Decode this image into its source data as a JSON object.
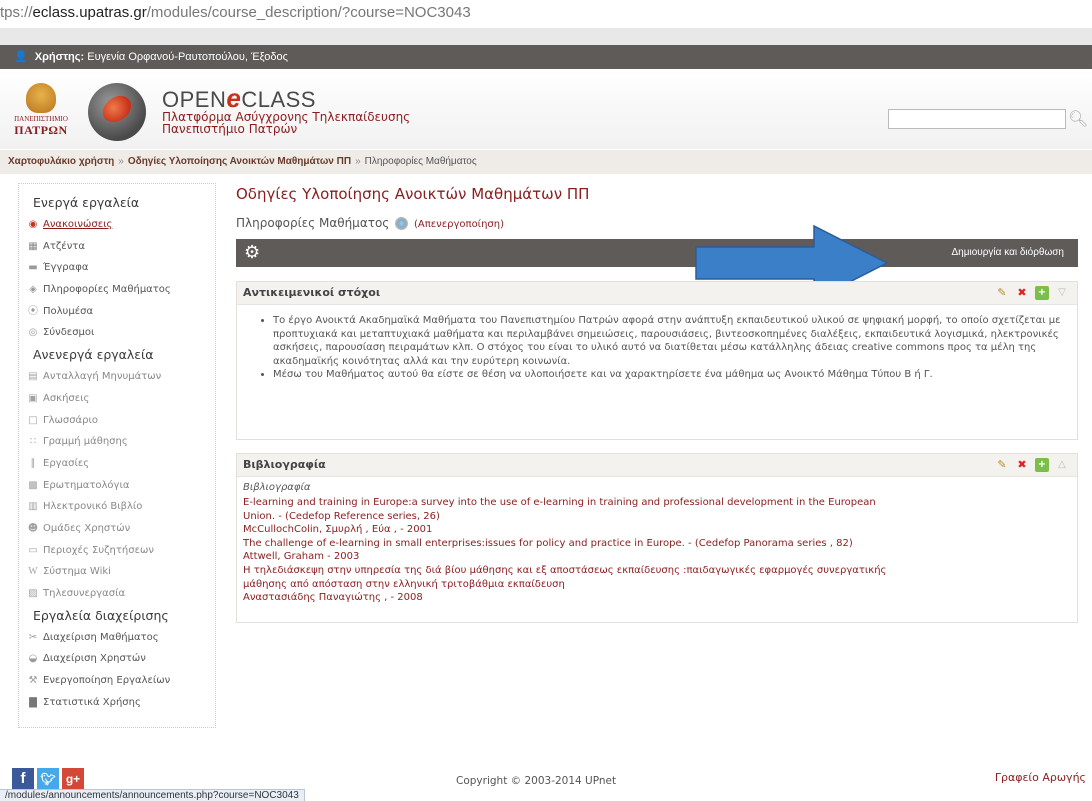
{
  "browser": {
    "url_prefix": "tps://",
    "url_host": "eclass.upatras.gr",
    "url_path": "/modules/course_description/?course=NOC3043",
    "status_url": "/modules/announcements/announcements.php?course=NOC3043"
  },
  "userbar": {
    "label": "Χρήστης:",
    "user": "Ευγενία Ορφανού-Ραυτοπούλου",
    "separator": ",",
    "logout": "Έξοδος"
  },
  "header": {
    "uni_line1": "ΠΑΝΕΠΙΣΤΗΜΙΟ",
    "uni_line2": "ΠΑΤΡΩΝ",
    "brand_open": "OPEN",
    "brand_e": "e",
    "brand_class": "CLASS",
    "subtitle1": "Πλατφόρμα Ασύγχρονης Τηλεκπαίδευσης",
    "subtitle2": "Πανεπιστήμιο Πατρών",
    "search_value": ""
  },
  "breadcrumb": {
    "item1": "Χαρτοφυλάκιο χρήστη",
    "sep": "»",
    "item2": "Οδηγίες Υλοποίησης Ανοικτών Μαθημάτων ΠΠ",
    "item3": "Πληροφορίες Μαθήματος"
  },
  "sidebar": {
    "active_heading": "Ενεργά εργαλεία",
    "active": [
      {
        "label": "Ανακοινώσεις"
      },
      {
        "label": "Ατζέντα"
      },
      {
        "label": "Έγγραφα"
      },
      {
        "label": "Πληροφορίες Μαθήματος"
      },
      {
        "label": "Πολυμέσα"
      },
      {
        "label": "Σύνδεσμοι"
      }
    ],
    "inactive_heading": "Ανενεργά εργαλεία",
    "inactive": [
      {
        "label": "Ανταλλαγή Μηνυμάτων"
      },
      {
        "label": "Ασκήσεις"
      },
      {
        "label": "Γλωσσάριο"
      },
      {
        "label": "Γραμμή μάθησης"
      },
      {
        "label": "Εργασίες"
      },
      {
        "label": "Ερωτηματολόγια"
      },
      {
        "label": "Ηλεκτρονικό Βιβλίο"
      },
      {
        "label": "Ομάδες Χρηστών"
      },
      {
        "label": "Περιοχές Συζητήσεων"
      },
      {
        "label": "Σύστημα Wiki"
      },
      {
        "label": "Τηλεσυνεργασία"
      }
    ],
    "admin_heading": "Εργαλεία διαχείρισης",
    "admin": [
      {
        "label": "Διαχείριση Μαθήματος"
      },
      {
        "label": "Διαχείριση Χρηστών"
      },
      {
        "label": "Ενεργοποίηση Εργαλείων"
      },
      {
        "label": "Στατιστικά Χρήσης"
      }
    ]
  },
  "main": {
    "title": "Οδηγίες Υλοποίησης Ανοικτών Μαθημάτων ΠΠ",
    "subtitle": "Πληροφορίες Μαθήματος",
    "deactivate": "(Απενεργοποίηση)",
    "create_edit": "Δημιουργία και διόρθωση",
    "goals_title": "Αντικειμενικοί στόχοι",
    "goals": [
      "Το έργο Ανοικτά Ακαδημαϊκά Μαθήματα του Πανεπιστημίου Πατρών αφορά στην ανάπτυξη εκπαιδευτικού υλικού σε ψηφιακή μορφή, το οποίο σχετίζεται με προπτυχιακά και μεταπτυχιακά μαθήματα και περιλαμβάνει σημειώσεις, παρουσιάσεις, βιντεοσκοπημένες διαλέξεις, εκπαιδευτικά λογισμικά, ηλεκτρονικές ασκήσεις, παρουσίαση πειραμάτων κλπ. Ο στόχος του είναι το υλικό αυτό να διατίθεται μέσω κατάλληλης άδειας creative commons προς τα μέλη της ακαδημαϊκής κοινότητας αλλά και την ευρύτερη κοινωνία.",
      "Μέσω του Μαθήματος αυτού θα είστε σε θέση να υλοποιήσετε και να χαρακτηρίσετε ένα μάθημα ως Ανοικτό Μάθημα Τύπου Β ή Γ."
    ],
    "biblio_title": "Βιβλιογραφία",
    "biblio_sub": "Βιβλιογραφία",
    "biblio_lines": [
      "E-learning and training in Europe:a survey into the use of e-learning in training and professional development in the European",
      "Union. - (Cedefop Reference series, 26)",
      "McCullochColin, Σμυρλή , Εύα , - 2001",
      "The challenge of e-learning in small enterprises:issues for policy and practice in Europe. - (Cedefop Panorama series , 82)",
      "Attwell, Graham - 2003",
      "Η τηλεδιάσκεψη στην υπηρεσία της διά βίου μάθησης και εξ αποστάσεως εκπαίδευσης :παιδαγωγικές εφαρμογές συνεργατικής",
      "μάθησης από απόσταση στην ελληνική τριτοβάθμια εκπαίδευση",
      "Αναστασιάδης Παναγιώτης , - 2008"
    ]
  },
  "footer": {
    "copyright": "Copyright © 2003-2014 UPnet",
    "helpdesk": "Γραφείο Αρωγής"
  },
  "colors": {
    "brand_red": "#8a1d1d",
    "bar_gray": "#5e5b58",
    "arrow_blue": "#3b7fc9"
  }
}
